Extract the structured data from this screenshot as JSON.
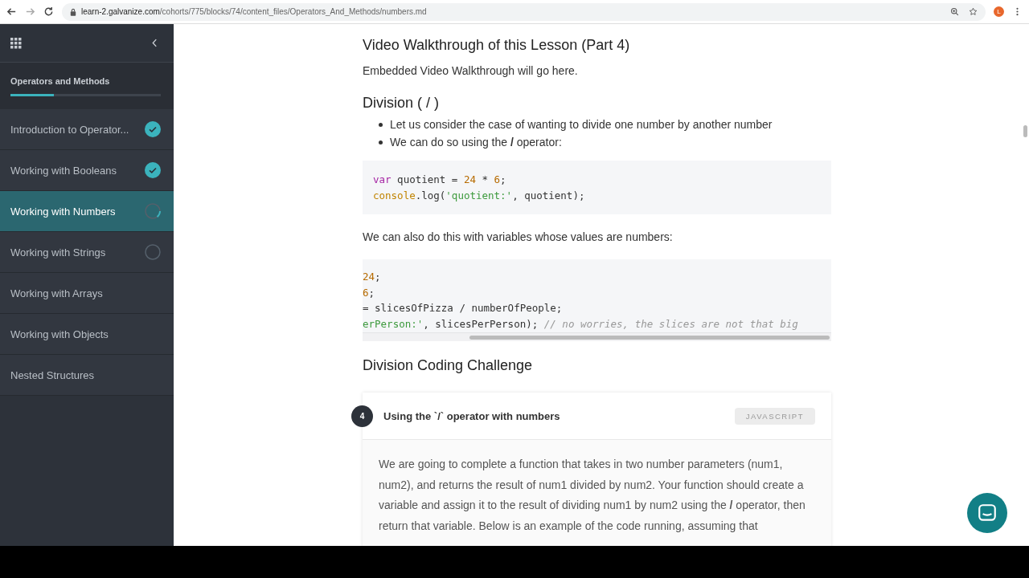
{
  "browser": {
    "url_host": "learn-2.galvanize.com",
    "url_path": "/cohorts/775/blocks/74/content_files/Operators_And_Methods/numbers.md",
    "profile_initial": "L"
  },
  "sidebar": {
    "course_title": "Operators and Methods",
    "progress": {
      "level": 0.29
    },
    "items": [
      {
        "label": "Introduction to Operator...",
        "kind": "complete",
        "selected": false
      },
      {
        "label": "Working with Booleans",
        "kind": "complete",
        "selected": false
      },
      {
        "label": "Working with Numbers",
        "kind": "started",
        "selected": true
      },
      {
        "label": "Working with Strings",
        "kind": "unstarted",
        "selected": false
      },
      {
        "label": "Working with Arrays",
        "kind": "plain",
        "selected": false
      },
      {
        "label": "Working with Objects",
        "kind": "plain",
        "selected": false
      },
      {
        "label": "Nested Structures",
        "kind": "plain",
        "selected": false
      }
    ]
  },
  "content": [
    {
      "kind": "heading",
      "text": "Video Walkthrough of this Lesson (Part 4)"
    },
    {
      "kind": "paragraph",
      "text": "Embedded Video Walkthrough will go here."
    },
    {
      "kind": "heading",
      "text": "Division ( / )"
    },
    {
      "kind": "bullets",
      "items": [
        "Let us consider the case of wanting to divide one number by another number",
        "We can do so using the **/** operator:"
      ]
    },
    {
      "kind": "code",
      "scrolled": false,
      "lines": [
        [
          {
            "kind": "keyword",
            "s": "var"
          },
          {
            "kind": "plain",
            "s": " quotient = "
          },
          {
            "kind": "number",
            "s": "24"
          },
          {
            "kind": "plain",
            "s": " * "
          },
          {
            "kind": "number",
            "s": "6"
          },
          {
            "kind": "plain",
            "s": ";"
          }
        ],
        [
          {
            "kind": "builtin",
            "s": "console"
          },
          {
            "kind": "plain",
            "s": ".log("
          },
          {
            "kind": "string",
            "s": "'quotient:'"
          },
          {
            "kind": "plain",
            "s": ", quotient);"
          }
        ]
      ]
    },
    {
      "kind": "paragraph",
      "text": "We can also do this with variables whose values are numbers:"
    },
    {
      "kind": "code",
      "scrolled": true,
      "lines": [
        [
          {
            "kind": "number",
            "s": "24"
          },
          {
            "kind": "plain",
            "s": ";"
          }
        ],
        [
          {
            "kind": "number",
            "s": "6"
          },
          {
            "kind": "plain",
            "s": ";"
          }
        ],
        [
          {
            "kind": "plain",
            "s": "= slicesOfPizza / numberOfPeople;"
          }
        ],
        [
          {
            "kind": "string",
            "s": "erPerson:'"
          },
          {
            "kind": "plain",
            "s": ", slicesPerPerson); "
          },
          {
            "kind": "comment",
            "s": "// no worries, the slices are not that big"
          }
        ]
      ]
    },
    {
      "kind": "heading",
      "text": "Division Coding Challenge"
    },
    {
      "kind": "challenge",
      "number": "4",
      "title": "Using the `/` operator with numbers",
      "language": "JAVASCRIPT",
      "text": "We are going to complete a function that takes in two number parameters (num1, num2), and returns the result of num1 divided by num2. Your function should create a variable and assign it to the result of dividing num1 by num2 using the **/** operator, then return that variable. Below is an example of the code running, assuming that"
    }
  ]
}
